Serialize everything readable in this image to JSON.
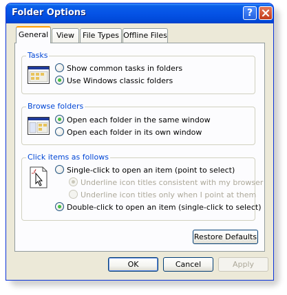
{
  "window": {
    "title": "Folder Options"
  },
  "tabs": [
    {
      "label": "General",
      "active": true
    },
    {
      "label": "View"
    },
    {
      "label": "File Types"
    },
    {
      "label": "Offline Files"
    }
  ],
  "tasks": {
    "legend": "Tasks",
    "icon": "folder-tasks-icon",
    "options": [
      {
        "label": "Show common tasks in folders",
        "checked": false
      },
      {
        "label": "Use Windows classic folders",
        "checked": true
      }
    ]
  },
  "browse": {
    "legend": "Browse folders",
    "icon": "folder-window-icon",
    "options": [
      {
        "label": "Open each folder in the same window",
        "checked": true
      },
      {
        "label": "Open each folder in its own window",
        "checked": false
      }
    ]
  },
  "click": {
    "legend": "Click items as follows",
    "icon": "pointer-click-icon",
    "options": [
      {
        "label": "Single-click to open an item (point to select)",
        "checked": false
      },
      {
        "label": "Underline icon titles consistent with my browser",
        "checked": true,
        "disabled": true
      },
      {
        "label": "Underline icon titles only when I point at them",
        "checked": false,
        "disabled": true
      },
      {
        "label": "Double-click to open an item (single-click to select)",
        "checked": true
      }
    ]
  },
  "buttons": {
    "restore_defaults": "Restore Defaults",
    "ok": "OK",
    "cancel": "Cancel",
    "apply": "Apply"
  },
  "colors": {
    "titlebar": "#0553e6",
    "legend": "#0046d5",
    "dialog": "#ece9d8"
  }
}
